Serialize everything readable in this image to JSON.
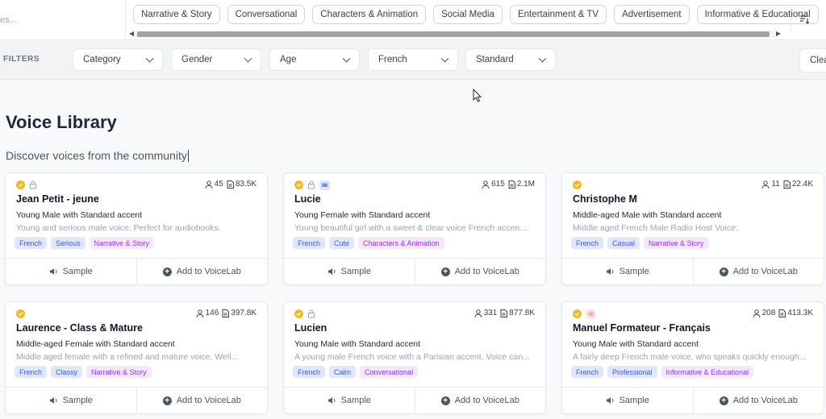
{
  "search": {
    "placeholder_fragment": "es..."
  },
  "category_chips": [
    "Narrative & Story",
    "Conversational",
    "Characters & Animation",
    "Social Media",
    "Entertainment & TV",
    "Advertisement",
    "Informative & Educational"
  ],
  "filters": {
    "label": "FILTERS",
    "category": "Category",
    "gender": "Gender",
    "age": "Age",
    "language": "French",
    "accent": "Standard",
    "clear": "Clea"
  },
  "page": {
    "title": "Voice Library",
    "subtitle": "Discover voices from the community"
  },
  "cards": [
    {
      "name": "Jean Petit - jeune",
      "users": "45",
      "chars": "83.5K",
      "accent": "Young Male with Standard accent",
      "desc": "Young and serious male voice. Perfect for audiobooks.",
      "tags": [
        "French",
        "Serious",
        "Narrative & Story"
      ],
      "sample": "Sample",
      "add": "Add to VoiceLab"
    },
    {
      "name": "Lucie",
      "users": "615",
      "chars": "2.1M",
      "accent": "Young Female with Standard accent",
      "desc": "Young beautiful girl with a sweet & clear voice French accen...",
      "tags": [
        "French",
        "Cute",
        "Characters & Animation"
      ],
      "sample": "Sample",
      "add": "Add to VoiceLab"
    },
    {
      "name": "Christophe M",
      "users": "11",
      "chars": "22.4K",
      "accent": "Middle-aged Male with Standard accent",
      "desc": "Middle aged French Male Radio Host Voice.",
      "tags": [
        "French",
        "Casual",
        "Narrative & Story"
      ],
      "sample": "Sample",
      "add": "Add to VoiceLab"
    },
    {
      "name": "Laurence - Class & Mature",
      "users": "146",
      "chars": "397.8K",
      "accent": "Middle-aged Female with Standard accent",
      "desc": "Middle aged female with a refined and mature voice. Well...",
      "tags": [
        "French",
        "Classy",
        "Narrative & Story"
      ],
      "sample": "Sample",
      "add": "Add to VoiceLab"
    },
    {
      "name": "Lucien",
      "users": "331",
      "chars": "877.8K",
      "accent": "Young Male with Standard accent",
      "desc": "A young male French voice with a Parisian accent. Voice can...",
      "tags": [
        "French",
        "Calm",
        "Conversational"
      ],
      "sample": "Sample",
      "add": "Add to VoiceLab"
    },
    {
      "name": "Manuel Formateur - Français",
      "users": "208",
      "chars": "413.3K",
      "accent": "Young Male with Standard accent",
      "desc": "A fairly deep French male voice, who speaks quickly enough...",
      "tags": [
        "French",
        "Professional",
        "Informative & Educational"
      ],
      "sample": "Sample",
      "add": "Add to VoiceLab"
    }
  ],
  "colors": {
    "verified": "#f5b829",
    "tag_blue": "#3b5bdb",
    "tag_purple": "#9333ea"
  }
}
